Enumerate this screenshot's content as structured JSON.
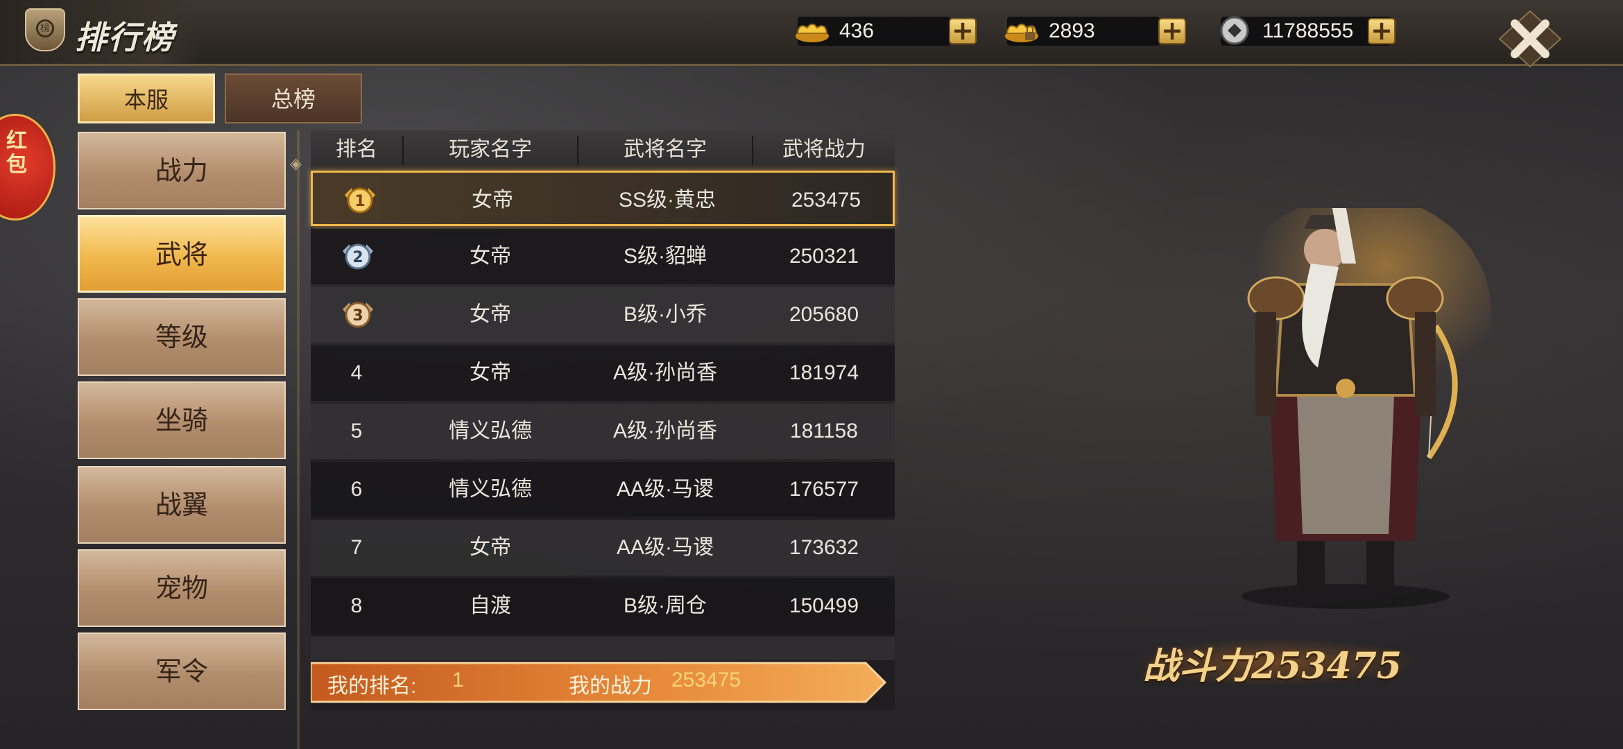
{
  "header": {
    "title": "排行榜",
    "currencies": [
      {
        "name": "gold-ingot",
        "value": "436"
      },
      {
        "name": "bound-gold-ingot",
        "value": "2893"
      },
      {
        "name": "silver-coin",
        "value": "11788555"
      }
    ],
    "plus_symbol": "+"
  },
  "side_badge": {
    "label": "红包"
  },
  "tabs": [
    {
      "label": "本服",
      "active": true
    },
    {
      "label": "总榜",
      "active": false
    }
  ],
  "categories": [
    {
      "label": "战力",
      "selected": false
    },
    {
      "label": "武将",
      "selected": true
    },
    {
      "label": "等级",
      "selected": false
    },
    {
      "label": "坐骑",
      "selected": false
    },
    {
      "label": "战翼",
      "selected": false
    },
    {
      "label": "宠物",
      "selected": false
    },
    {
      "label": "军令",
      "selected": false
    }
  ],
  "table": {
    "headers": [
      "排名",
      "玩家名字",
      "武将名字",
      "武将战力"
    ],
    "rows": [
      {
        "rank": "1",
        "player": "女帝",
        "general": "SS级·黄忠",
        "power": "253475"
      },
      {
        "rank": "2",
        "player": "女帝",
        "general": "S级·貂蝉",
        "power": "250321"
      },
      {
        "rank": "3",
        "player": "女帝",
        "general": "B级·小乔",
        "power": "205680"
      },
      {
        "rank": "4",
        "player": "女帝",
        "general": "A级·孙尚香",
        "power": "181974"
      },
      {
        "rank": "5",
        "player": "情义弘德",
        "general": "A级·孙尚香",
        "power": "181158"
      },
      {
        "rank": "6",
        "player": "情义弘德",
        "general": "AA级·马谡",
        "power": "176577"
      },
      {
        "rank": "7",
        "player": "女帝",
        "general": "AA级·马谡",
        "power": "173632"
      },
      {
        "rank": "8",
        "player": "自渡",
        "general": "B级·周仓",
        "power": "150499"
      }
    ]
  },
  "my_rank": {
    "rank_label": "我的排名:",
    "rank_value": "1",
    "power_label": "我的战力",
    "power_value": "253475"
  },
  "hero_panel": {
    "combat_power_label": "战斗力",
    "combat_power_value": "253475"
  },
  "colors": {
    "gold": "#f0b74c",
    "tab_active": "#f7d78a",
    "category_selected": "#f0b84d"
  }
}
